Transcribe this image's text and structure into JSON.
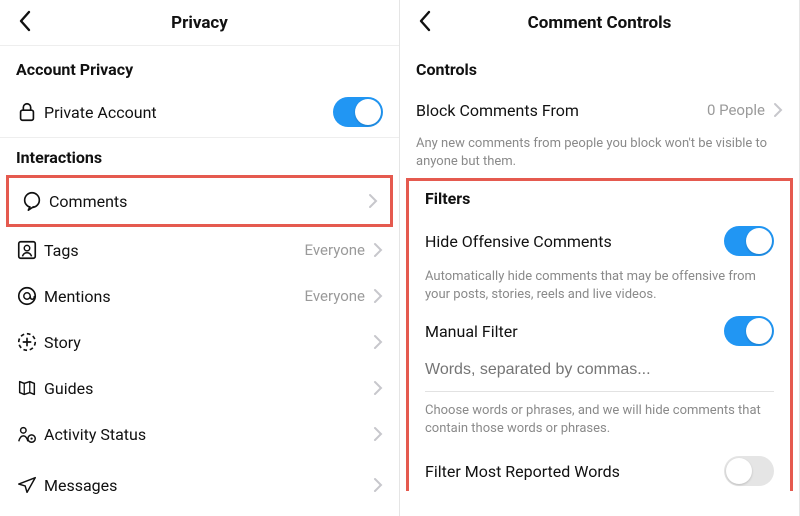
{
  "left": {
    "header": {
      "title": "Privacy"
    },
    "account": {
      "section": "Account Privacy",
      "private_account": "Private Account",
      "private_account_on": true
    },
    "interactions": {
      "section": "Interactions",
      "items": [
        {
          "label": "Comments",
          "value": ""
        },
        {
          "label": "Tags",
          "value": "Everyone"
        },
        {
          "label": "Mentions",
          "value": "Everyone"
        },
        {
          "label": "Story",
          "value": ""
        },
        {
          "label": "Guides",
          "value": ""
        },
        {
          "label": "Activity Status",
          "value": ""
        },
        {
          "label": "Messages",
          "value": ""
        }
      ]
    }
  },
  "right": {
    "header": {
      "title": "Comment Controls"
    },
    "controls": {
      "section": "Controls",
      "block_label": "Block Comments From",
      "block_value": "0 People",
      "block_desc": "Any new comments from people you block won't be visible to anyone but them."
    },
    "filters": {
      "section": "Filters",
      "hide_label": "Hide Offensive Comments",
      "hide_desc": "Automatically hide comments that may be offensive from your posts, stories, reels and live videos.",
      "manual_label": "Manual Filter",
      "manual_placeholder": "Words, separated by commas...",
      "manual_desc": "Choose words or phrases, and we will hide comments that contain those words or phrases.",
      "reported_label": "Filter Most Reported Words"
    }
  }
}
